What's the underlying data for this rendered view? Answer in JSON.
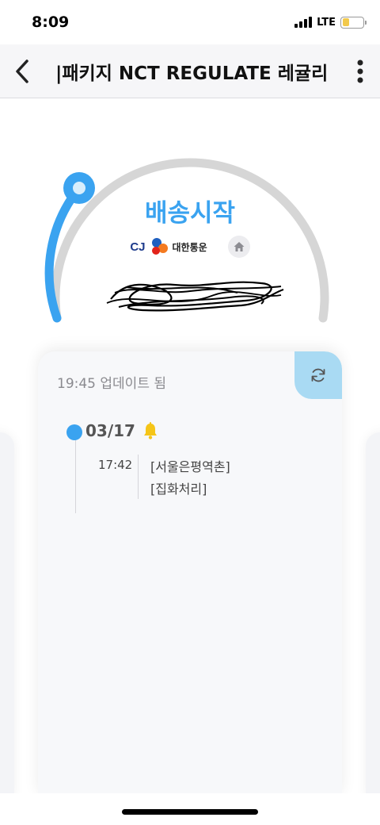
{
  "status_bar": {
    "time": "8:09",
    "network": "LTE",
    "battery_level": 0.35,
    "battery_color": "#f2c94c"
  },
  "nav": {
    "back_icon": "chevron-left-icon",
    "title": "|패키지 NCT REGULATE 레귤리",
    "more_icon": "more-vertical-icon"
  },
  "delivery": {
    "status": "배송시작",
    "progress": 0.12,
    "accent_color": "#3aa3f0",
    "carrier": {
      "logo_text": "CJ",
      "name": "대한통운"
    },
    "home_icon": "home-icon",
    "tracking_number_redacted": true
  },
  "card": {
    "updated_text": "19:45 업데이트 됨",
    "refresh_icon": "refresh-icon",
    "events": [
      {
        "date": "03/17",
        "bell_icon": "bell-icon",
        "time": "17:42",
        "location_lines": [
          "[서울은평역촌]",
          "[집화처리]"
        ]
      }
    ]
  }
}
